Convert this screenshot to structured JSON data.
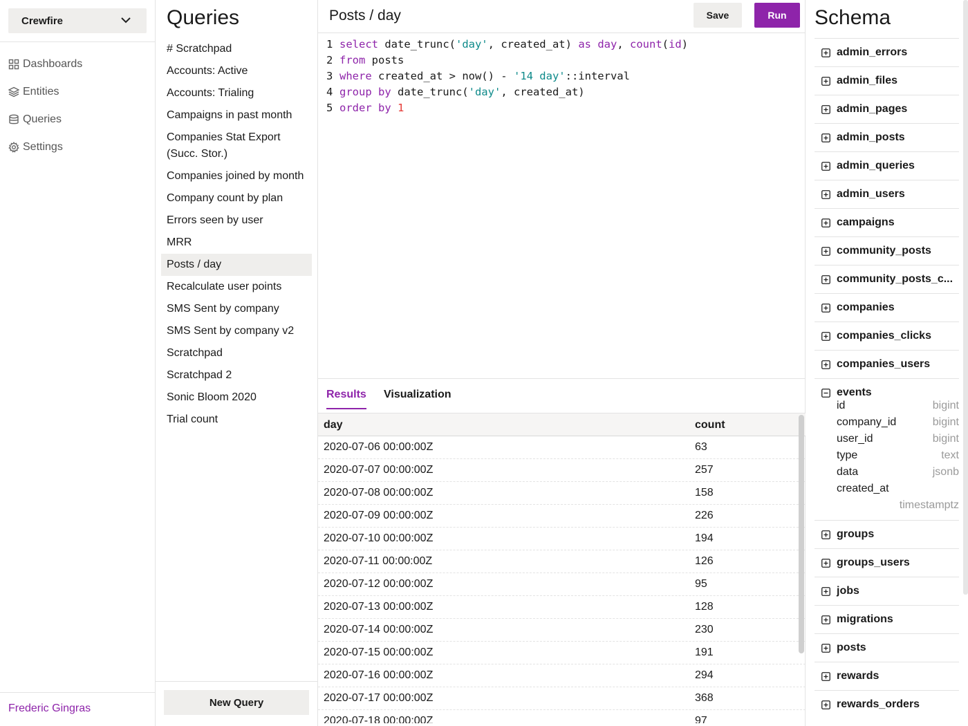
{
  "nav": {
    "org": "Crewfire",
    "items": [
      {
        "label": "Dashboards",
        "icon": "grid-icon"
      },
      {
        "label": "Entities",
        "icon": "layers-icon"
      },
      {
        "label": "Queries",
        "icon": "database-icon"
      },
      {
        "label": "Settings",
        "icon": "gear-icon"
      }
    ],
    "user": "Frederic Gingras"
  },
  "queries": {
    "title": "Queries",
    "items": [
      "# Scratchpad",
      "Accounts: Active",
      "Accounts: Trialing",
      "Campaigns in past month",
      "Companies Stat Export (Succ. Stor.)",
      "Companies joined by month",
      "Company count by plan",
      "Errors seen by user",
      "MRR",
      "Posts / day",
      "Recalculate user points",
      "SMS Sent by company",
      "SMS Sent by company v2",
      "Scratchpad",
      "Scratchpad 2",
      "Sonic Bloom 2020",
      "Trial count"
    ],
    "active": "Posts / day",
    "new_query": "New Query"
  },
  "editor": {
    "title": "Posts / day",
    "save": "Save",
    "run": "Run",
    "line_numbers": [
      "1",
      "2",
      "3",
      "4",
      "5"
    ]
  },
  "results": {
    "tabs": [
      "Results",
      "Visualization"
    ],
    "active_tab": "Results",
    "columns": [
      "day",
      "count"
    ],
    "rows": [
      [
        "2020-07-06 00:00:00Z",
        "63"
      ],
      [
        "2020-07-07 00:00:00Z",
        "257"
      ],
      [
        "2020-07-08 00:00:00Z",
        "158"
      ],
      [
        "2020-07-09 00:00:00Z",
        "226"
      ],
      [
        "2020-07-10 00:00:00Z",
        "194"
      ],
      [
        "2020-07-11 00:00:00Z",
        "126"
      ],
      [
        "2020-07-12 00:00:00Z",
        "95"
      ],
      [
        "2020-07-13 00:00:00Z",
        "128"
      ],
      [
        "2020-07-14 00:00:00Z",
        "230"
      ],
      [
        "2020-07-15 00:00:00Z",
        "191"
      ],
      [
        "2020-07-16 00:00:00Z",
        "294"
      ],
      [
        "2020-07-17 00:00:00Z",
        "368"
      ],
      [
        "2020-07-18 00:00:00Z",
        "97"
      ]
    ]
  },
  "schema": {
    "title": "Schema",
    "tables": [
      {
        "name": "admin_errors"
      },
      {
        "name": "admin_files"
      },
      {
        "name": "admin_pages"
      },
      {
        "name": "admin_posts"
      },
      {
        "name": "admin_queries"
      },
      {
        "name": "admin_users"
      },
      {
        "name": "campaigns"
      },
      {
        "name": "community_posts"
      },
      {
        "name": "community_posts_c..."
      },
      {
        "name": "companies"
      },
      {
        "name": "companies_clicks"
      },
      {
        "name": "companies_users"
      },
      {
        "name": "events",
        "expanded": true,
        "columns": [
          {
            "name": "id",
            "type": "bigint"
          },
          {
            "name": "company_id",
            "type": "bigint"
          },
          {
            "name": "user_id",
            "type": "bigint"
          },
          {
            "name": "type",
            "type": "text"
          },
          {
            "name": "data",
            "type": "jsonb"
          },
          {
            "name": "created_at",
            "type": "timestamptz"
          }
        ]
      },
      {
        "name": "groups"
      },
      {
        "name": "groups_users"
      },
      {
        "name": "jobs"
      },
      {
        "name": "migrations"
      },
      {
        "name": "posts"
      },
      {
        "name": "rewards"
      },
      {
        "name": "rewards_orders"
      }
    ]
  },
  "colors": {
    "accent": "#8e24aa",
    "button_bg": "#efeeec",
    "string": "#0e8a8a",
    "number": "#e53935"
  }
}
